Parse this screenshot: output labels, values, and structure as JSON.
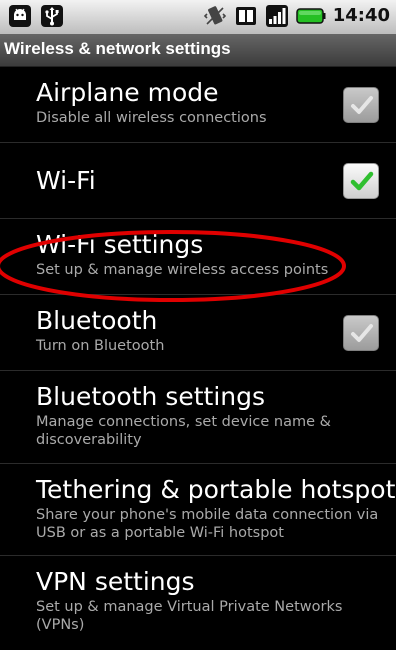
{
  "status_bar": {
    "time": "14:40",
    "left_icons": [
      "android-debug-icon",
      "usb-icon"
    ],
    "right_icons": [
      "vibrate-icon",
      "sim-icon",
      "signal-icon",
      "battery-icon"
    ],
    "battery_color": "#26c024"
  },
  "header": {
    "title": "Wireless & network settings"
  },
  "items": [
    {
      "title": "Airplane mode",
      "summary": "Disable all wireless connections",
      "checkbox": "checked-disabled"
    },
    {
      "title": "Wi-Fi",
      "summary": "",
      "checkbox": "checked"
    },
    {
      "title": "Wi-Fi settings",
      "summary": "Set up & manage wireless access points",
      "checkbox": null
    },
    {
      "title": "Bluetooth",
      "summary": "Turn on Bluetooth",
      "checkbox": "checked-disabled"
    },
    {
      "title": "Bluetooth settings",
      "summary": "Manage connections, set device name & discoverability",
      "checkbox": null
    },
    {
      "title": "Tethering & portable hotspot",
      "summary": "Share your phone's mobile data connection via USB or as a portable Wi-Fi hotspot",
      "checkbox": null
    },
    {
      "title": "VPN settings",
      "summary": "Set up & manage Virtual Private Networks (VPNs)",
      "checkbox": null
    }
  ],
  "annotation": {
    "highlight_color": "#e00000",
    "highlighted_item": "Wi-Fi settings"
  }
}
